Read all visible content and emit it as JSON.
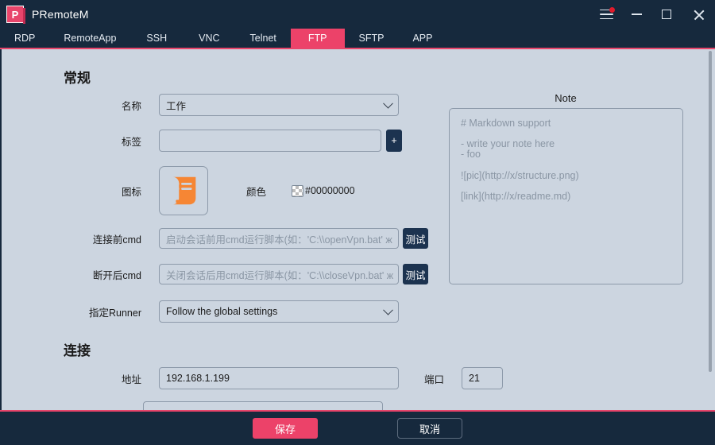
{
  "window": {
    "app_title": "PRemoteM",
    "logo_letter": "P",
    "controls": {
      "menu": "hamburger-menu",
      "minimize": "minimize",
      "maximize": "maximize",
      "close": "close"
    }
  },
  "tabs": [
    {
      "label": "RDP",
      "active": false
    },
    {
      "label": "RemoteApp",
      "active": false
    },
    {
      "label": "SSH",
      "active": false
    },
    {
      "label": "VNC",
      "active": false
    },
    {
      "label": "Telnet",
      "active": false
    },
    {
      "label": "FTP",
      "active": true
    },
    {
      "label": "SFTP",
      "active": false
    },
    {
      "label": "APP",
      "active": false
    }
  ],
  "general": {
    "heading": "常规",
    "name": {
      "label": "名称",
      "value": "工作"
    },
    "tags": {
      "label": "标签",
      "value": "",
      "add_button": "+"
    },
    "icon": {
      "label": "图标",
      "icon_name": "orange-scroll-document-icon"
    },
    "color": {
      "label": "颜色",
      "value": "#00000000"
    },
    "pre_cmd": {
      "label": "连接前cmd",
      "value": "",
      "placeholder": "启动会话前用cmd运行脚本(如：'C:\\\\openVpn.bat' ж",
      "test_button": "测试"
    },
    "post_cmd": {
      "label": "断开后cmd",
      "value": "",
      "placeholder": "关闭会话后用cmd运行脚本(如：'C:\\\\closeVpn.bat' ж",
      "test_button": "测试"
    },
    "runner": {
      "label": "指定Runner",
      "value": "Follow the global settings"
    }
  },
  "connection": {
    "heading": "连接",
    "address": {
      "label": "地址",
      "value": "192.168.1.199"
    },
    "port": {
      "label": "端口",
      "value": "21"
    },
    "next_field": {
      "value": ""
    }
  },
  "note": {
    "title": "Note",
    "placeholder": "# Markdown support\n\n- write your note here\n- foo\n\n![pic](http://x/structure.png)\n\n[link](http://x/readme.md)"
  },
  "footer": {
    "save": "保存",
    "cancel": "取消"
  },
  "colors": {
    "titlebar": "#16293d",
    "accent": "#ec4269",
    "panel_bg": "#ccd5e0",
    "dark_button": "#1c3350",
    "icon_orange": "#f68634"
  }
}
